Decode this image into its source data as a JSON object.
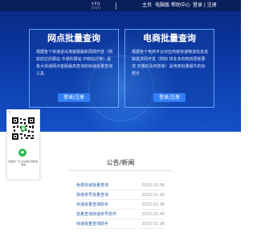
{
  "header": {
    "logo_main": "XPQ",
    "logo_sub": "JUJU",
    "nav": [
      "主页",
      "电脑版",
      "帮助中心",
      "登录 | 注册"
    ]
  },
  "cards": [
    {
      "title": "网点批量查询",
      "desc": "根据各个快递进出港客服最新局网开放（例如前达的驿站 中通的驿站 中转站迁移）是各大快递网点客服最高查询的快递批量查询工具",
      "button": "登录/注册"
    },
    {
      "title": "电商批量查询",
      "desc": "根据各个电商平台对应商家快递物流信息追踪需求而开发（例如 拼多多的物流更新要求 天猫的及时揽收）是电商批量最牛的好帮手",
      "button": "登录/注册"
    }
  ],
  "qr_panel": {
    "close": "×",
    "caption": "微信扫一扫 关注我们获取优惠券"
  },
  "news": {
    "title": "公告/新闻",
    "items": [
      {
        "title": "免费快递批量查询",
        "date": "2025.01.06"
      },
      {
        "title": "快递单号批量查询",
        "date": "2025.01.06"
      },
      {
        "title": "快递批量查询助手",
        "date": "2025.01.06"
      },
      {
        "title": "批量查询快递单号软件",
        "date": "2025.01.06"
      },
      {
        "title": "快递批量查询助手",
        "date": "2025.01.06"
      }
    ]
  },
  "colors": {
    "topbar": "#0a1e5a",
    "hero_dark": "#0a2a86",
    "hero_light": "#1452c8",
    "button": "#2f7ef5",
    "link": "#2a5db0"
  }
}
